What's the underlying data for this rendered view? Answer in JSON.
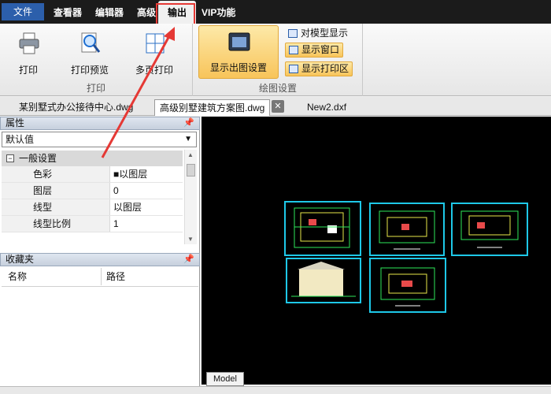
{
  "menubar": {
    "file": "文件",
    "items": [
      "查看器",
      "编辑器",
      "高级"
    ],
    "active": "输出",
    "vip": "VIP功能"
  },
  "ribbon": {
    "print_group": {
      "label": "打印",
      "buttons": [
        "打印",
        "打印预览",
        "多页打印"
      ]
    },
    "plot_group": {
      "label": "绘图设置",
      "display_button": "显示出图设置",
      "small_buttons": [
        "对模型显示",
        "显示窗口",
        "显示打印区"
      ]
    }
  },
  "tabs": [
    "某别墅式办公接待中心.dwg",
    "高级别墅建筑方案图.dwg",
    "New2.dxf"
  ],
  "properties": {
    "header": "属性",
    "dropdown_value": "默认值",
    "group_label": "一般设置",
    "rows": [
      {
        "name": "色彩",
        "value": "■以图层"
      },
      {
        "name": "图层",
        "value": "0"
      },
      {
        "name": "线型",
        "value": "以图层"
      },
      {
        "name": "线型比例",
        "value": "1"
      }
    ]
  },
  "favorites": {
    "header": "收藏夹",
    "col_name": "名称",
    "col_path": "路径"
  },
  "canvas": {
    "model_tab": "Model"
  },
  "colors": {
    "menu_bg": "#1b1b1b",
    "accent": "#f8c45a",
    "highlight": "#e53935",
    "drawing_frame": "#1ec8e8"
  }
}
